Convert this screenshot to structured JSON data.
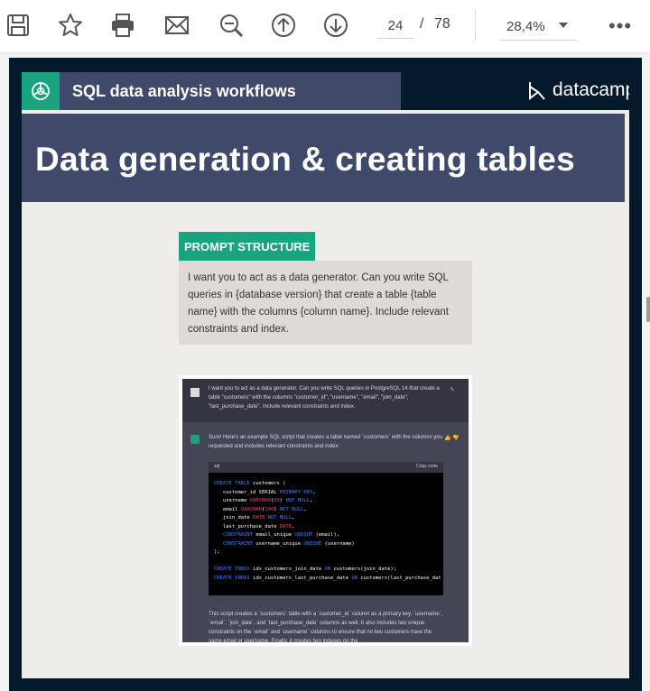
{
  "toolbar": {
    "buttons": [
      "save-icon",
      "star-icon",
      "print-icon",
      "mail-icon",
      "zoom-out-icon",
      "arrow-up-icon",
      "arrow-down-icon"
    ],
    "page_current": "24",
    "page_separator": "/",
    "page_total": "78",
    "zoom": "28,4%",
    "more": "•••"
  },
  "slide": {
    "topbar_title": "SQL data analysis workflows",
    "brand": "datacamp",
    "title": "Data generation & creating tables",
    "prompt_label": "PROMPT STRUCTURE",
    "prompt_text": "I want you to act as a data generator. Can you write SQL queries in {database version} that create a table {table name} with the columns {column name}. Include relevant constraints and index.",
    "chat": {
      "user_message": "I want you to act as a data generator. Can you write SQL queries in PostgreSQL 14 that create a table \"customers\" with the columns \"customer_id\", \"username\", \"email\", \"join_date\", \"last_purchase_date\". Include relevant constraints and index.",
      "bot_intro": "Sure! Here's an example SQL script that creates a table named `customers` with the columns you requested and includes relevant constraints and index:",
      "code_lang": "sql",
      "code_copy": "Copy code",
      "bot_outro": "This script creates a `customers` table with a `customer_id` column as a primary key, `username`, `email`, `join_date`, and `last_purchase_date` columns as well. It also includes two unique constraints on the `email` and `username` columns to ensure that no two customers have the same email or username. Finally, it creates two indexes on the"
    }
  },
  "colors": {
    "accent_green": "#19a37f",
    "slide_navy": "#05192d",
    "band_slate": "#3f4a6a"
  }
}
